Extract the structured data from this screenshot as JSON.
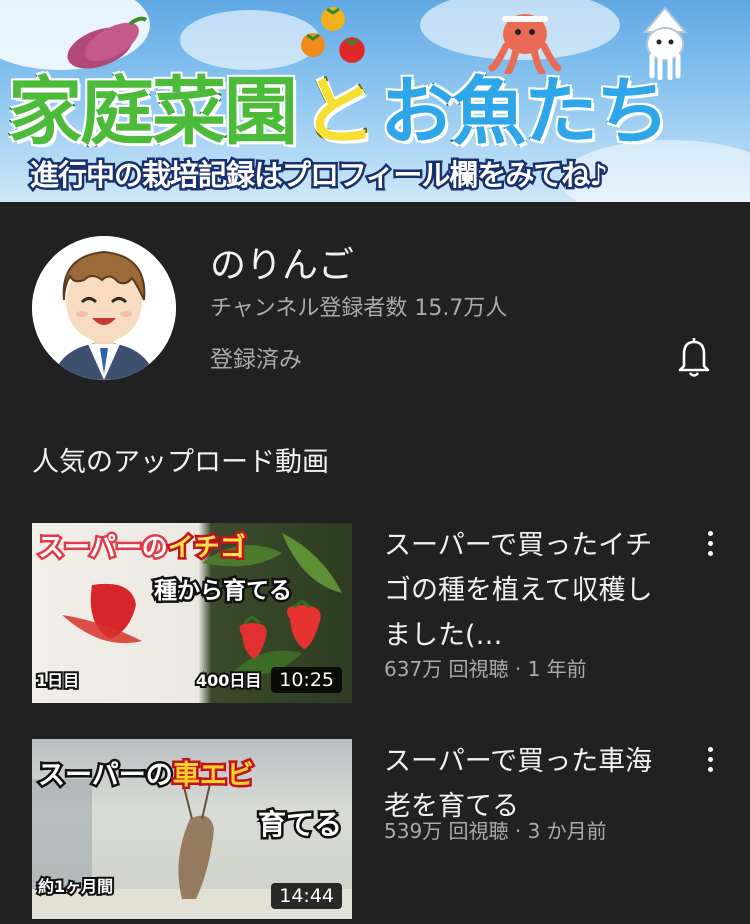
{
  "banner": {
    "title_part1": "家庭菜園",
    "title_part2": "と",
    "title_part3": "お魚たち",
    "subtitle": "進行中の栽培記録はプロフィール欄をみてね♪"
  },
  "channel": {
    "name": "のりんご",
    "subscribers": "チャンネル登録者数 15.7万人",
    "subscribed_label": "登録済み"
  },
  "section_title": "人気のアップロード動画",
  "videos": [
    {
      "title": "スーパーで買ったイチゴの種を植えて収穫しました(…",
      "meta": "637万 回視聴 · 1 年前",
      "duration": "10:25",
      "thumb_text1": "スーパーの",
      "thumb_text2": "イチゴ",
      "thumb_text3": "種から育てる",
      "thumb_text4": "1日目",
      "thumb_text5": "400日目"
    },
    {
      "title": "スーパーで買った車海老を育てる",
      "meta": "539万 回視聴 · 3 か月前",
      "duration": "14:44",
      "thumb_text1": "スーパーの",
      "thumb_text2": "車エビ",
      "thumb_text3": "育てる",
      "thumb_text4": "約1ヶ月間"
    }
  ],
  "colors": {
    "background": "#212121",
    "secondary_text": "#aaaaaa",
    "banner_green": "#4dbb3a",
    "banner_yellow": "#f6df33",
    "banner_blue": "#2ea6ea"
  },
  "icons": [
    "bell-icon",
    "more-vert-icon"
  ]
}
